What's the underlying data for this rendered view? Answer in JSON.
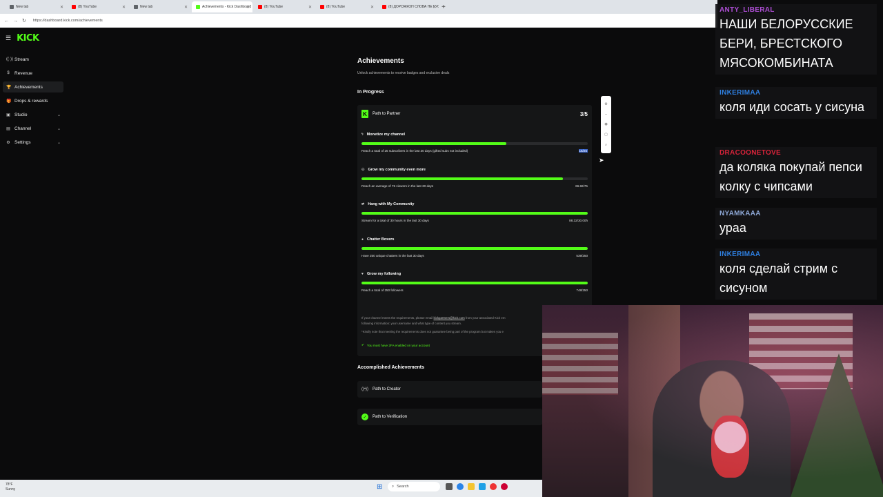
{
  "browser": {
    "tabs": [
      {
        "label": "New tab",
        "color": "#5f6368"
      },
      {
        "label": "(8) YouTube",
        "color": "#ff0000"
      },
      {
        "label": "New tab",
        "color": "#5f6368"
      },
      {
        "label": "Achievements - Kick Dashboard",
        "color": "#53fc18",
        "active": true
      },
      {
        "label": "(8) YouTube",
        "color": "#ff0000"
      },
      {
        "label": "(8) YouTube",
        "color": "#ff0000"
      },
      {
        "label": "(8) ДОРОЖКОН СЛОВА НЕ ГУСО",
        "color": "#ff0000"
      }
    ],
    "url": "https://dashboard.kick.com/achievements"
  },
  "sidebar": {
    "logo": "KICK",
    "items": [
      {
        "label": "Stream",
        "icon": "broadcast-icon"
      },
      {
        "label": "Revenue",
        "icon": "money-icon"
      },
      {
        "label": "Achievements",
        "icon": "trophy-icon",
        "active": true
      },
      {
        "label": "Drops & rewards",
        "icon": "gift-icon"
      },
      {
        "label": "Studio",
        "icon": "studio-icon",
        "expandable": true
      },
      {
        "label": "Channel",
        "icon": "channel-icon",
        "expandable": true
      },
      {
        "label": "Settings",
        "icon": "gear-icon",
        "expandable": true
      }
    ]
  },
  "main": {
    "title": "Achievements",
    "subtitle": "Unlock achievements to receive badges and exclusive deals",
    "in_progress_heading": "In Progress",
    "card": {
      "title": "Path to Partner",
      "score": "3/5",
      "items": [
        {
          "title": "Monetize my channel",
          "desc": "Reach a total of 25 subscribers in the last 30 days (gifted subs not included)",
          "value": "16/25",
          "progress": 0.64,
          "highlight": true
        },
        {
          "title": "Grow my community even more",
          "desc": "Reach an average of 75 viewers in the last 30 days",
          "value": "66.82/75",
          "progress": 0.89
        },
        {
          "title": "Hang with My Community",
          "desc": "Stream for a total of 30 hours in the last 30 days",
          "value": "88.32/30.00h",
          "progress": 1.0
        },
        {
          "title": "Chatter Boxers",
          "desc": "Have 250 unique chatters in the last 30 days",
          "value": "539/250",
          "progress": 1.0
        },
        {
          "title": "Grow my following",
          "desc": "Reach a total of 250 followers",
          "value": "748/250",
          "progress": 1.0
        }
      ],
      "note_pre": "If your channel meets the requirements, please email ",
      "note_email": "kickpartners@kick.com",
      "note_post": " from your associated Kick em",
      "note_line2": "following information: your username and what type of content you stream.",
      "note_line3": "*Kindly note that meeting the requirements does not guarantee being part of the program but makes you e",
      "twofa": "You must have 2FA enabled on your account"
    },
    "accomplished_heading": "Accomplished Achievements",
    "accomplished": [
      {
        "title": "Path to Creator"
      },
      {
        "title": "Path to Verification"
      }
    ]
  },
  "chat": [
    {
      "user": "ANTY_LIBERAL",
      "color": "#b04fd8",
      "text": "НАШИ БЕЛОРУССКИЕ БЕРИ, БРЕСТСКОГО МЯСОКОМБИНАТА"
    },
    {
      "user": "INKERIMAA",
      "color": "#2e7fe0",
      "text": "коля иди сосать у сисуна"
    },
    {
      "user": "DRACOONETOVE",
      "color": "#d9233a",
      "text": "да коляка покупай пепси колку с чипсами"
    },
    {
      "user": "NYAMKAAA",
      "color": "#8fa9d8",
      "text": "ураа"
    },
    {
      "user": "INKERIMAA",
      "color": "#2e7fe0",
      "text": "коля сделай стрим с сисуном"
    }
  ],
  "taskbar": {
    "weather_temp": "78°F",
    "weather_desc": "Sunny",
    "search_label": "Search"
  }
}
